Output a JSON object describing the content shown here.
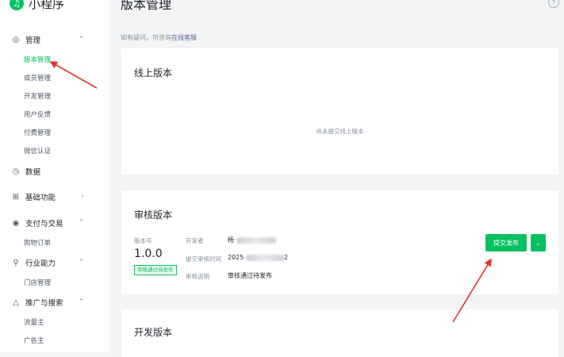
{
  "brand": {
    "name": "小程序"
  },
  "sidebar": {
    "groups": [
      {
        "label": "管理",
        "icon": "◎",
        "chevron": "⌃"
      },
      {
        "label": "数据",
        "icon": "◷"
      },
      {
        "label": "基础功能",
        "icon": "⊞",
        "chevron": "›"
      },
      {
        "label": "支付与交易",
        "icon": "◉",
        "chevron": "⌃"
      },
      {
        "label": "行业能力",
        "icon": "⚲",
        "chevron": "⌃"
      },
      {
        "label": "推广与搜索",
        "icon": "△",
        "chevron": "⌃"
      }
    ],
    "management_items": [
      "版本管理",
      "成员管理",
      "开发管理",
      "用户反馈",
      "付费管理",
      "微信认证"
    ],
    "payment_items": [
      "购物订单"
    ],
    "industry_items": [
      "门店管理"
    ],
    "promotion_items": [
      "流量主",
      "广告主"
    ]
  },
  "header": {
    "title": "版本管理",
    "help_icon": "?",
    "hint_prefix": "如有疑问，可咨询",
    "hint_link": "在线客服"
  },
  "online_version": {
    "title": "线上版本",
    "empty_text": "尚未提交线上版本"
  },
  "review_version": {
    "title": "审核版本",
    "version_label": "版本号",
    "version_number": "1.0.0",
    "status_tag": "审核通过待发布",
    "developer_label": "开发者",
    "developer_value": "杨",
    "submit_time_label": "提交审核时间",
    "submit_time_value": "2025",
    "submit_time_suffix": "2",
    "note_label": "审核说明",
    "note_value": "审核通过待发布",
    "submit_button": "提交发布",
    "more_icon": "⌄"
  },
  "dev_version": {
    "title": "开发版本"
  },
  "colors": {
    "accent": "#07c160",
    "annotation_arrow": "#e0342a",
    "link": "#576b95"
  }
}
